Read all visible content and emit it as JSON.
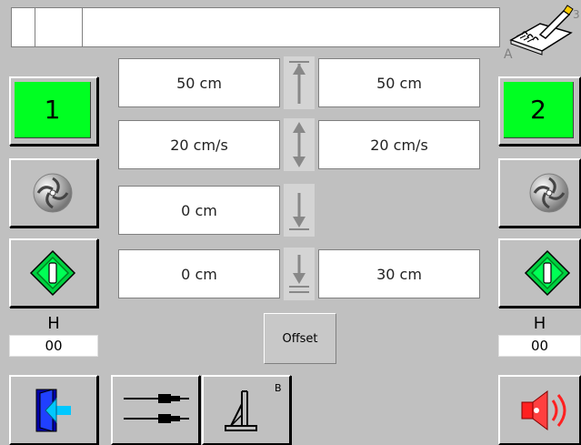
{
  "channel_left": {
    "label": "1",
    "h_label": "H",
    "h_value": "00"
  },
  "channel_right": {
    "label": "2",
    "h_label": "H",
    "h_value": "00"
  },
  "fields": {
    "row1_left": "50 cm",
    "row1_right": "50 cm",
    "row2_left": "20 cm/s",
    "row2_right": "20 cm/s",
    "row3_left": "0 cm",
    "row4_left": "0 cm",
    "row4_right": "30 cm"
  },
  "offset_label": "Offset",
  "b_superscript": "B",
  "icons": {
    "notes": "notepad-pen-icon",
    "rotate": "spiral-disc-icon",
    "start": "diamond-start-icon",
    "exit": "exit-door-icon",
    "cables": "cable-connectors-icon",
    "stand": "stand-b-icon",
    "alarm": "speaker-alarm-icon",
    "arrow_top": "arrow-to-top-icon",
    "arrow_both": "arrow-both-icon",
    "arrow_down": "arrow-down-icon",
    "arrow_down_line": "arrow-down-line-icon"
  },
  "colors": {
    "active_green": "#00ff22",
    "start_green": "#00cc44",
    "alarm_red": "#ff2020"
  }
}
